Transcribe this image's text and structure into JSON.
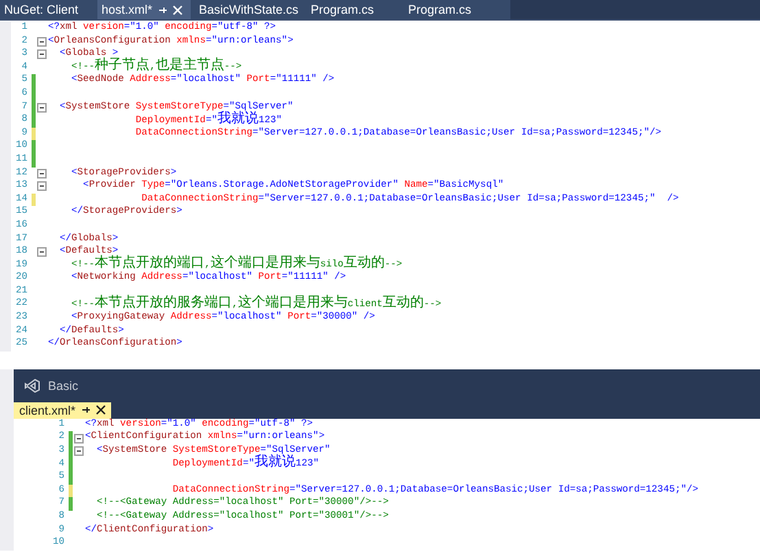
{
  "top_tabs": [
    {
      "label": "NuGet: Client",
      "selected": false
    },
    {
      "label": "host.xml*",
      "selected": true
    },
    {
      "label": "BasicWithState.cs",
      "selected": false
    },
    {
      "label": "Program.cs",
      "selected": false
    },
    {
      "label": "Program.cs",
      "selected": false
    }
  ],
  "editor": {
    "lines": [
      {
        "number": "1",
        "fold": false,
        "tokens": [
          {
            "kind": "delim",
            "text": "<?"
          },
          {
            "kind": "tag",
            "text": "xml"
          },
          {
            "kind": "attr",
            "text": " version"
          },
          {
            "kind": "value",
            "text": "=\"1.0\""
          },
          {
            "kind": "attr",
            "text": " encoding"
          },
          {
            "kind": "value",
            "text": "=\"utf-8\""
          },
          {
            "kind": "delim",
            "text": " ?>"
          }
        ]
      },
      {
        "number": "2",
        "fold": true,
        "tokens": [
          {
            "kind": "delim",
            "text": "<"
          },
          {
            "kind": "tag",
            "text": "OrleansConfiguration"
          },
          {
            "kind": "attr",
            "text": " xmlns"
          },
          {
            "kind": "value",
            "text": "=\"urn:orleans\""
          },
          {
            "kind": "delim",
            "text": ">"
          }
        ]
      },
      {
        "number": "3",
        "fold": true,
        "tokens": [
          {
            "kind": "delim",
            "text": "  <"
          },
          {
            "kind": "tag",
            "text": "Globals"
          },
          {
            "kind": "delim",
            "text": " >"
          }
        ]
      },
      {
        "number": "4",
        "fold": false,
        "tokens": [
          {
            "kind": "comment",
            "text": "    <!--种子节点,也是主节点-->"
          }
        ]
      },
      {
        "number": "5",
        "fold": false,
        "color": "#57b846",
        "tokens": [
          {
            "kind": "delim",
            "text": "    <"
          },
          {
            "kind": "tag",
            "text": "SeedNode"
          },
          {
            "kind": "attr",
            "text": " Address"
          },
          {
            "kind": "value",
            "text": "=\"localhost\""
          },
          {
            "kind": "attr",
            "text": " Port"
          },
          {
            "kind": "value",
            "text": "=\"11111\""
          },
          {
            "kind": "delim",
            "text": " />"
          }
        ]
      },
      {
        "number": "6",
        "fold": false,
        "color": "#57b846"
      },
      {
        "number": "7",
        "fold": true,
        "color": "#57b846",
        "tokens": [
          {
            "kind": "delim",
            "text": "  <"
          },
          {
            "kind": "tag",
            "text": "SystemStore"
          },
          {
            "kind": "attr",
            "text": " SystemStoreType"
          },
          {
            "kind": "value",
            "text": "=\"SqlServer\""
          }
        ]
      },
      {
        "number": "8",
        "fold": false,
        "color": "#57b846",
        "tokens": [
          {
            "kind": "attr",
            "text": "               DeploymentId"
          },
          {
            "kind": "value",
            "text": "=\"我就说123\""
          }
        ]
      },
      {
        "number": "9",
        "fold": false,
        "color": "#efe37a",
        "tokens": [
          {
            "kind": "attr",
            "text": "               DataConnectionString"
          },
          {
            "kind": "value",
            "text": "=\"Server=127.0.0.1;Database=OrleansBasic;User Id=sa;Password=12345;\""
          },
          {
            "kind": "delim",
            "text": "/>"
          }
        ]
      },
      {
        "number": "10",
        "fold": false,
        "color": "#57b846"
      },
      {
        "number": "11",
        "fold": false,
        "color": "#57b846"
      },
      {
        "number": "12",
        "fold": true,
        "tokens": [
          {
            "kind": "delim",
            "text": "    <"
          },
          {
            "kind": "tag",
            "text": "StorageProviders"
          },
          {
            "kind": "delim",
            "text": ">"
          }
        ]
      },
      {
        "number": "13",
        "fold": true,
        "tokens": [
          {
            "kind": "delim",
            "text": "      <"
          },
          {
            "kind": "tag",
            "text": "Provider"
          },
          {
            "kind": "attr",
            "text": " Type"
          },
          {
            "kind": "value",
            "text": "=\"Orleans.Storage.AdoNetStorageProvider\""
          },
          {
            "kind": "attr",
            "text": " Name"
          },
          {
            "kind": "value",
            "text": "=\"BasicMysql\""
          }
        ]
      },
      {
        "number": "14",
        "fold": false,
        "color": "#efe37a",
        "tokens": [
          {
            "kind": "attr",
            "text": "                DataConnectionString"
          },
          {
            "kind": "value",
            "text": "=\"Server=127.0.0.1;Database=OrleansBasic;User Id=sa;Password=12345;\""
          },
          {
            "kind": "delim",
            "text": "  />"
          }
        ]
      },
      {
        "number": "15",
        "fold": false,
        "tokens": [
          {
            "kind": "delim",
            "text": "    </"
          },
          {
            "kind": "tag",
            "text": "StorageProviders"
          },
          {
            "kind": "delim",
            "text": ">"
          }
        ]
      },
      {
        "number": "16",
        "fold": false
      },
      {
        "number": "17",
        "fold": false,
        "tokens": [
          {
            "kind": "delim",
            "text": "  </"
          },
          {
            "kind": "tag",
            "text": "Globals"
          },
          {
            "kind": "delim",
            "text": ">"
          }
        ]
      },
      {
        "number": "18",
        "fold": true,
        "tokens": [
          {
            "kind": "delim",
            "text": "  <"
          },
          {
            "kind": "tag",
            "text": "Defaults"
          },
          {
            "kind": "delim",
            "text": ">"
          }
        ]
      },
      {
        "number": "19",
        "fold": false,
        "tokens": [
          {
            "kind": "comment",
            "text": "    <!--本节点开放的端口,这个端口是用来与silo互动的-->"
          }
        ]
      },
      {
        "number": "20",
        "fold": false,
        "tokens": [
          {
            "kind": "delim",
            "text": "    <"
          },
          {
            "kind": "tag",
            "text": "Networking"
          },
          {
            "kind": "attr",
            "text": " Address"
          },
          {
            "kind": "value",
            "text": "=\"localhost\""
          },
          {
            "kind": "attr",
            "text": " Port"
          },
          {
            "kind": "value",
            "text": "=\"11111\""
          },
          {
            "kind": "delim",
            "text": " />"
          }
        ]
      },
      {
        "number": "21",
        "fold": false
      },
      {
        "number": "22",
        "fold": false,
        "tokens": [
          {
            "kind": "comment",
            "text": "    <!--本节点开放的服务端口,这个端口是用来与client互动的-->"
          }
        ]
      },
      {
        "number": "23",
        "fold": false,
        "tokens": [
          {
            "kind": "delim",
            "text": "    <"
          },
          {
            "kind": "tag",
            "text": "ProxyingGateway"
          },
          {
            "kind": "attr",
            "text": " Address"
          },
          {
            "kind": "value",
            "text": "=\"localhost\""
          },
          {
            "kind": "attr",
            "text": " Port"
          },
          {
            "kind": "value",
            "text": "=\"30000\""
          },
          {
            "kind": "delim",
            "text": " />"
          }
        ]
      },
      {
        "number": "24",
        "fold": false,
        "tokens": [
          {
            "kind": "delim",
            "text": "  </"
          },
          {
            "kind": "tag",
            "text": "Defaults"
          },
          {
            "kind": "delim",
            "text": ">"
          }
        ]
      },
      {
        "number": "25",
        "fold": false,
        "tokens": [
          {
            "kind": "delim",
            "text": "</"
          },
          {
            "kind": "tag",
            "text": "OrleansConfiguration"
          },
          {
            "kind": "delim",
            "text": ">"
          }
        ]
      }
    ]
  },
  "lower_panel": {
    "title": "Basic",
    "tabs": [
      {
        "label": "client.xml*",
        "selected": true
      }
    ],
    "editor": {
      "lines": [
        {
          "number": "1",
          "fold": false,
          "tokens": [
            {
              "kind": "delim",
              "text": "<?"
            },
            {
              "kind": "tag",
              "text": "xml"
            },
            {
              "kind": "attr",
              "text": " version"
            },
            {
              "kind": "value",
              "text": "=\"1.0\""
            },
            {
              "kind": "attr",
              "text": " encoding"
            },
            {
              "kind": "value",
              "text": "=\"utf-8\""
            },
            {
              "kind": "delim",
              "text": " ?>"
            }
          ]
        },
        {
          "number": "2",
          "fold": true,
          "color": "#57b846",
          "tokens": [
            {
              "kind": "delim",
              "text": "<"
            },
            {
              "kind": "tag",
              "text": "ClientConfiguration"
            },
            {
              "kind": "attr",
              "text": " xmlns"
            },
            {
              "kind": "value",
              "text": "=\"urn:orleans\""
            },
            {
              "kind": "delim",
              "text": ">"
            }
          ]
        },
        {
          "number": "3",
          "fold": true,
          "color": "#57b846",
          "tokens": [
            {
              "kind": "delim",
              "text": "  <"
            },
            {
              "kind": "tag",
              "text": "SystemStore"
            },
            {
              "kind": "attr",
              "text": " SystemStoreType"
            },
            {
              "kind": "value",
              "text": "=\"SqlServer\""
            }
          ]
        },
        {
          "number": "4",
          "fold": false,
          "color": "#57b846",
          "tokens": [
            {
              "kind": "attr",
              "text": "               DeploymentId"
            },
            {
              "kind": "value",
              "text": "=\"我就说123\""
            }
          ]
        },
        {
          "number": "5",
          "fold": false,
          "color": "#57b846"
        },
        {
          "number": "6",
          "fold": false,
          "color": "#efe37a",
          "tokens": [
            {
              "kind": "attr",
              "text": "               DataConnectionString"
            },
            {
              "kind": "value",
              "text": "=\"Server=127.0.0.1;Database=OrleansBasic;User Id=sa;Password=12345;\""
            },
            {
              "kind": "delim",
              "text": "/>"
            }
          ]
        },
        {
          "number": "7",
          "fold": false,
          "color": "#57b846",
          "tokens": [
            {
              "kind": "comment",
              "text": "  <!--<Gateway Address=\"localhost\" Port=\"30000\"/>-->"
            }
          ]
        },
        {
          "number": "8",
          "fold": false,
          "tokens": [
            {
              "kind": "comment",
              "text": "  <!--<Gateway Address=\"localhost\" Port=\"30001\"/>-->"
            }
          ]
        },
        {
          "number": "9",
          "fold": false,
          "tokens": [
            {
              "kind": "delim",
              "text": "</"
            },
            {
              "kind": "tag",
              "text": "ClientConfiguration"
            },
            {
              "kind": "delim",
              "text": ">"
            }
          ]
        },
        {
          "number": "10",
          "fold": false
        }
      ]
    }
  }
}
